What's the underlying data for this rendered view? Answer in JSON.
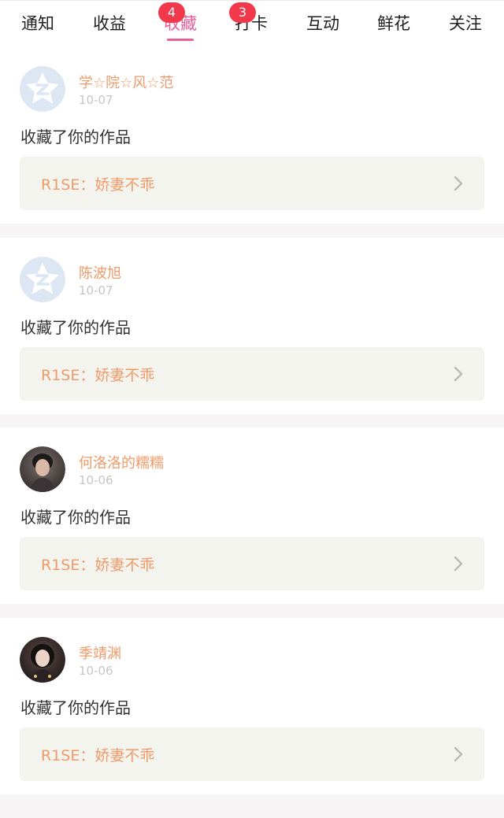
{
  "tabs": [
    {
      "label": "通知",
      "badge": null,
      "active": false
    },
    {
      "label": "收益",
      "badge": null,
      "active": false
    },
    {
      "label": "收藏",
      "badge": "4",
      "active": true
    },
    {
      "label": "打卡",
      "badge": "3",
      "active": false
    },
    {
      "label": "互动",
      "badge": null,
      "active": false
    },
    {
      "label": "鲜花",
      "badge": null,
      "active": false
    },
    {
      "label": "关注",
      "badge": null,
      "active": false
    }
  ],
  "colors": {
    "accent": "#e8609a",
    "badge": "#f2384b",
    "username": "#ef9a6a",
    "work_title": "#ef9a6a",
    "work_bg": "#f4f4ee",
    "date": "#c6c6c6"
  },
  "notifications": [
    {
      "username": "学☆院☆风☆范",
      "date": "10-07",
      "action": "收藏了你的作品",
      "work_title": "R1SE：娇妻不乖",
      "avatar": "default-qq-avatar"
    },
    {
      "username": "陈波旭",
      "date": "10-07",
      "action": "收藏了你的作品",
      "work_title": "R1SE：娇妻不乖",
      "avatar": "default-qq-avatar"
    },
    {
      "username": "何洛洛的糯糯",
      "date": "10-06",
      "action": "收藏了你的作品",
      "work_title": "R1SE：娇妻不乖",
      "avatar": "user-photo-avatar"
    },
    {
      "username": "季靖渊",
      "date": "10-06",
      "action": "收藏了你的作品",
      "work_title": "R1SE：娇妻不乖",
      "avatar": "user-photo-avatar"
    }
  ]
}
